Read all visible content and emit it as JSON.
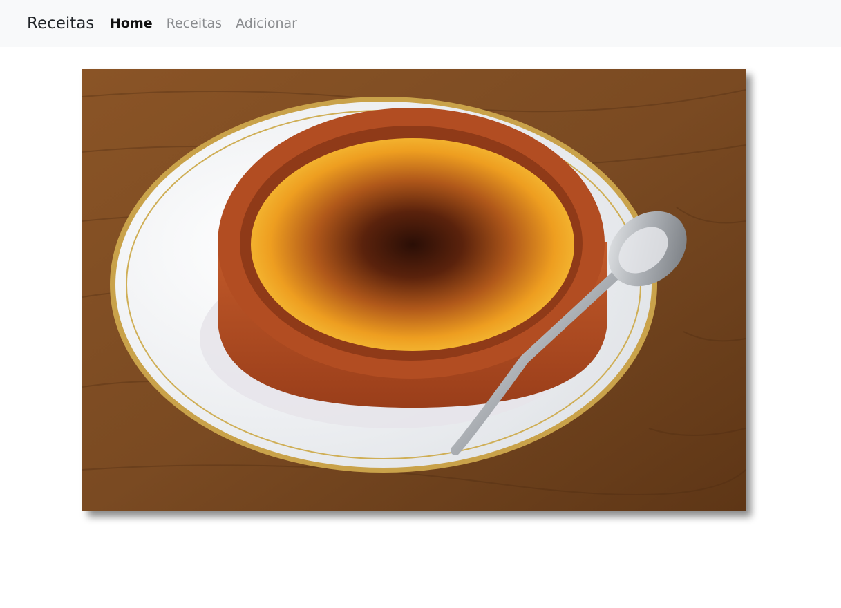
{
  "navbar": {
    "brand": "Receitas",
    "items": [
      {
        "label": "Home",
        "active": true
      },
      {
        "label": "Receitas",
        "active": false
      },
      {
        "label": "Adicionar",
        "active": false
      }
    ]
  },
  "hero": {
    "subject": "crème brûlée in terracotta dish with spoon on plate",
    "colors": {
      "table": "#7a4a22",
      "plate": "#eef0f2",
      "dish": "#b44e22",
      "custard": "#f0a022",
      "caramel": "#3a1608",
      "spoon": "#c8cbcf"
    }
  }
}
